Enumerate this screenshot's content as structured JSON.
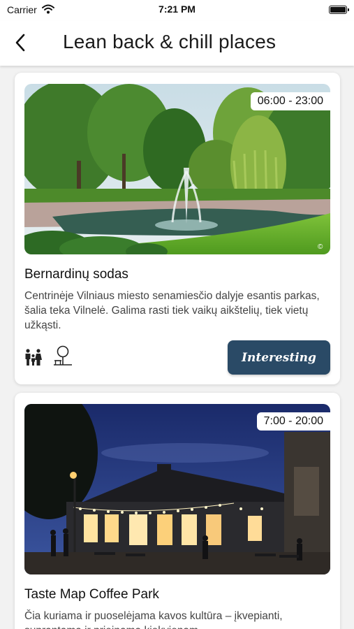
{
  "status_bar": {
    "carrier": "Carrier",
    "time": "7:21 PM"
  },
  "header": {
    "title": "Lean back & chill places"
  },
  "places": [
    {
      "hours": "06:00 - 23:00",
      "name": "Bernardinų sodas",
      "description": "Centrinėje Vilniaus miesto senamiesčio dalyje esantis parkas, šalia teka Vilnelė. Galima rasti tiek vaikų aikštelių, tiek vietų užkąsti.",
      "amenity_icons": [
        "family-icon",
        "tree-bench-icon"
      ],
      "button_label": "Interesting",
      "photo_copyright": "©"
    },
    {
      "hours": "7:00 - 20:00",
      "name": "Taste Map Coffee Park",
      "description": "Čia kuriama ir puoselėjama kavos kultūra – įkvepianti, suprantama ir prieinama kiekvienam."
    }
  ],
  "colors": {
    "accent": "#2a4a66",
    "background": "#f2f2f2"
  }
}
